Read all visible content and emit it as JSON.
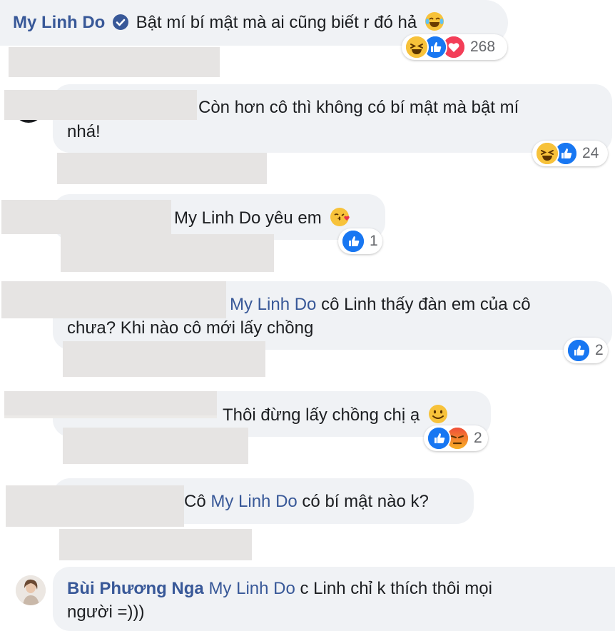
{
  "comments": [
    {
      "author": "My Linh Do",
      "text": "Bật mí bí mật mà ai cũng biết r đó hả",
      "reactions": [
        "haha",
        "like",
        "love"
      ],
      "count": "268"
    },
    {
      "line1": "Còn hơn cô thì không có bí mật mà bật mí",
      "line2": "nhá!",
      "reactions": [
        "haha",
        "like"
      ],
      "count": "24"
    },
    {
      "text": "My Linh Do yêu em",
      "reactions": [
        "like"
      ],
      "count": "1"
    },
    {
      "mention": "My Linh Do",
      "line1_rest": "cô Linh thấy đàn em của cô",
      "line2": "chưa? Khi nào cô mới lấy chồng",
      "reactions": [
        "like"
      ],
      "count": "2"
    },
    {
      "text": "Thôi đừng lấy chồng chị ạ",
      "reactions": [
        "like",
        "angry"
      ],
      "count": "2"
    },
    {
      "prefix": "Cô",
      "mention": "My Linh Do",
      "suffix": "có bí mật nào k?"
    },
    {
      "author": "Bùi Phương Nga",
      "mention": "My Linh Do",
      "line1_rest": "c Linh chỉ k thích thôi mọi",
      "line2": "người =)))"
    }
  ],
  "colors": {
    "link": "#385898",
    "bubble": "#f0f2f5",
    "like": "#1877f2",
    "love": "#f33e58",
    "haha": "#f7b125",
    "angry": "#e9710f"
  }
}
